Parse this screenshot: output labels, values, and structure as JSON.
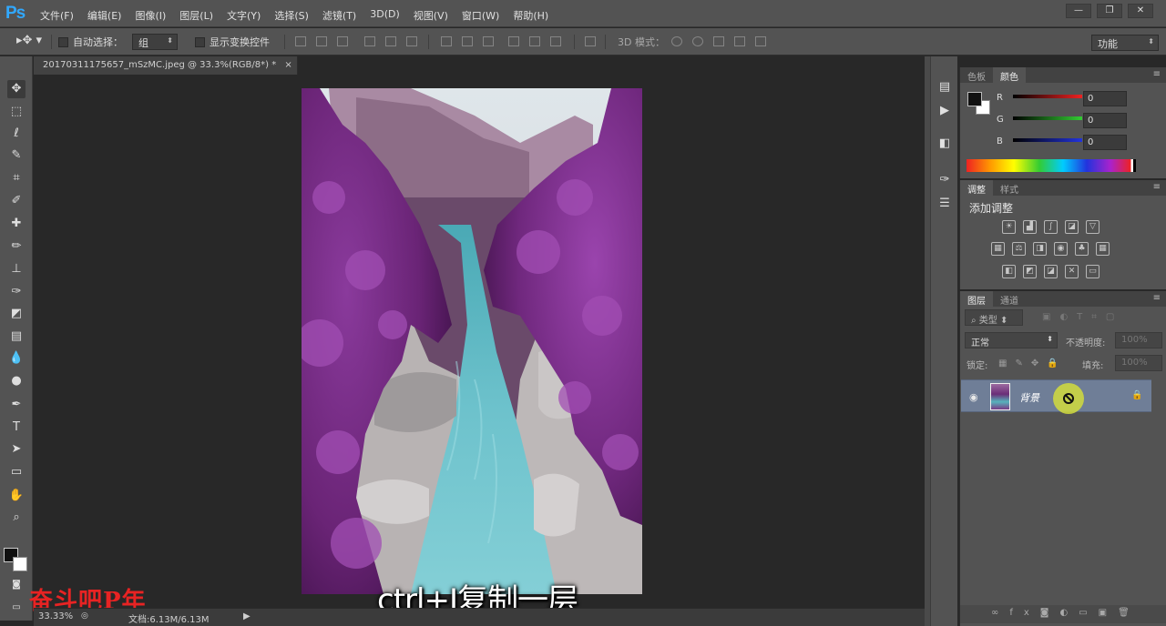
{
  "app": {
    "logo": "Ps",
    "menu": [
      "文件(F)",
      "编辑(E)",
      "图像(I)",
      "图层(L)",
      "文字(Y)",
      "选择(S)",
      "滤镜(T)",
      "3D(D)",
      "视图(V)",
      "窗口(W)",
      "帮助(H)"
    ],
    "window_buttons": [
      "—",
      "❐",
      "✕"
    ]
  },
  "options_bar": {
    "auto_select_label": "自动选择：",
    "auto_select_value": "组",
    "show_transform_label": "显示变换控件",
    "mode_3d_label": "3D 模式：",
    "workspace": "功能"
  },
  "document": {
    "tab_title": "20170311175657_mSzMC.jpeg @ 33.3%(RGB/8*) *",
    "close_glyph": "×",
    "zoom": "33.33%",
    "doc_size": "文档:6.13M/6.13M"
  },
  "overlay": {
    "caption": "ctrl+J复制一层",
    "watermark": "奋斗吧P年"
  },
  "color_panel": {
    "tabs": [
      "色板",
      "颜色"
    ],
    "active_tab": "颜色",
    "channels": [
      {
        "label": "R",
        "value": "0",
        "color": "#d22b2b"
      },
      {
        "label": "G",
        "value": "0",
        "color": "#3cb043"
      },
      {
        "label": "B",
        "value": "0",
        "color": "#2b49d2"
      }
    ]
  },
  "adjustments_panel": {
    "tabs": [
      "调整",
      "样式"
    ],
    "active_tab": "调整",
    "title": "添加调整"
  },
  "layers_panel": {
    "tabs": [
      "图层",
      "通道"
    ],
    "active_tab": "图层",
    "filter_kind": "类型",
    "blend_mode": "正常",
    "opacity_label": "不透明度:",
    "opacity_value": "100%",
    "lock_label": "锁定:",
    "fill_label": "填充:",
    "fill_value": "100%",
    "layers": [
      {
        "name": "背景",
        "visible": true,
        "locked": true
      }
    ]
  }
}
